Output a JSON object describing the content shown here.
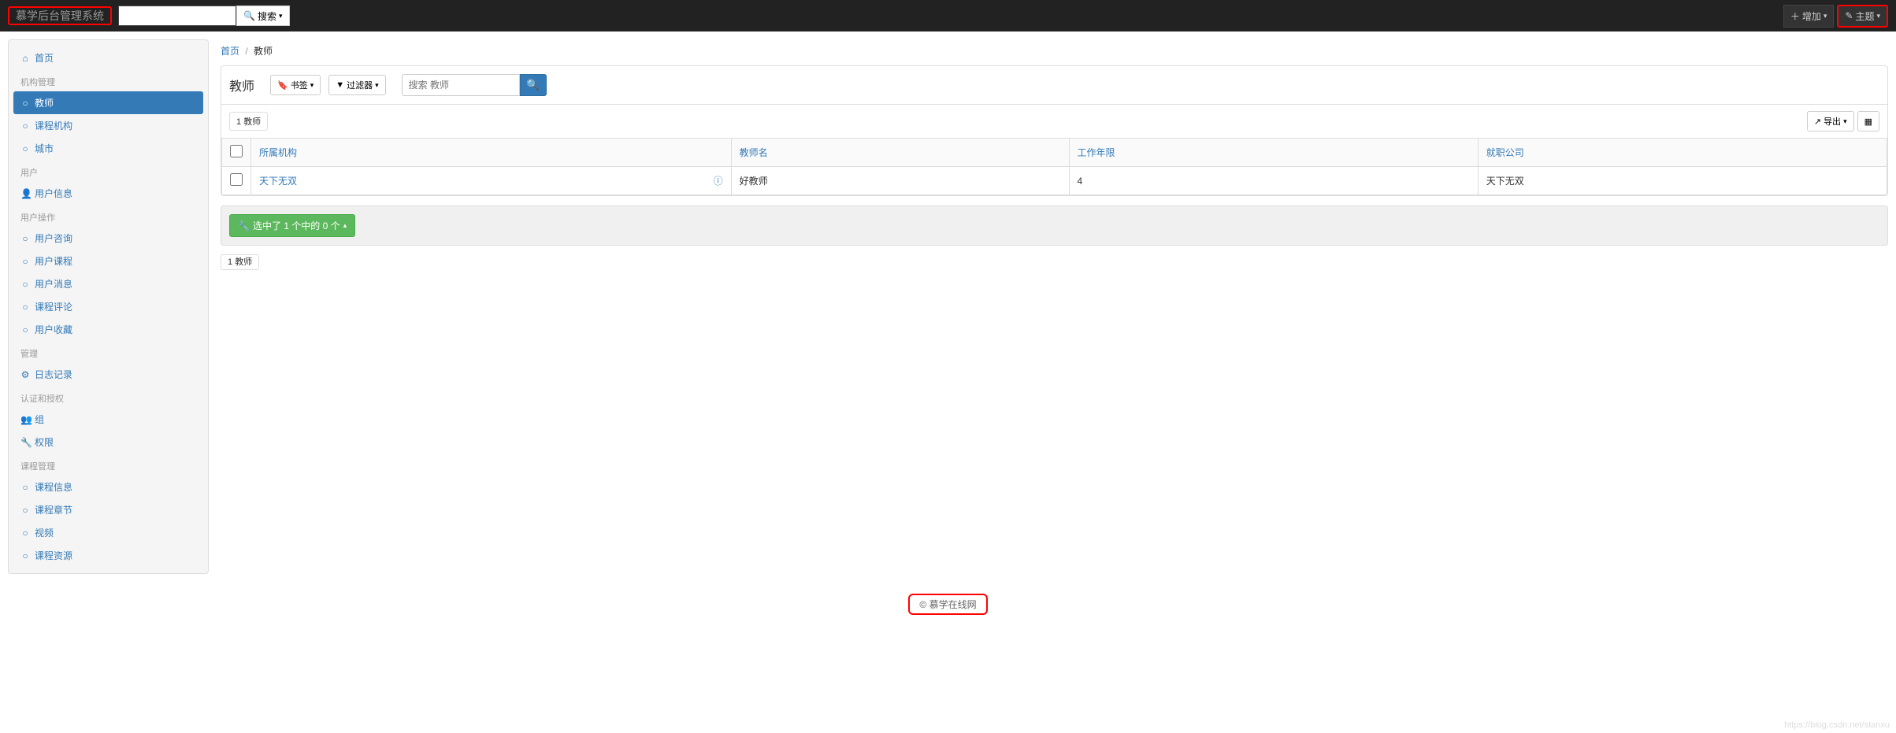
{
  "navbar": {
    "brand": "慕学后台管理系统",
    "search_btn": "搜索",
    "add_btn": "增加",
    "theme_btn": "主题"
  },
  "sidebar": {
    "home": "首页",
    "groups": [
      {
        "title": "机构管理",
        "items": [
          {
            "label": "教师",
            "icon": "○",
            "active": true
          },
          {
            "label": "课程机构",
            "icon": "○"
          },
          {
            "label": "城市",
            "icon": "○"
          }
        ]
      },
      {
        "title": "用户",
        "items": [
          {
            "label": "用户信息",
            "icon": "👤"
          }
        ]
      },
      {
        "title": "用户操作",
        "items": [
          {
            "label": "用户咨询",
            "icon": "○"
          },
          {
            "label": "用户课程",
            "icon": "○"
          },
          {
            "label": "用户消息",
            "icon": "○"
          },
          {
            "label": "课程评论",
            "icon": "○"
          },
          {
            "label": "用户收藏",
            "icon": "○"
          }
        ]
      },
      {
        "title": "管理",
        "items": [
          {
            "label": "日志记录",
            "icon": "⚙"
          }
        ]
      },
      {
        "title": "认证和授权",
        "items": [
          {
            "label": "组",
            "icon": "👥"
          },
          {
            "label": "权限",
            "icon": "🔧"
          }
        ]
      },
      {
        "title": "课程管理",
        "items": [
          {
            "label": "课程信息",
            "icon": "○"
          },
          {
            "label": "课程章节",
            "icon": "○"
          },
          {
            "label": "视频",
            "icon": "○"
          },
          {
            "label": "课程资源",
            "icon": "○"
          }
        ]
      }
    ]
  },
  "breadcrumb": {
    "home": "首页",
    "current": "教师"
  },
  "toolbar": {
    "title": "教师",
    "bookmark": "书签",
    "filter": "过滤器",
    "search_placeholder": "搜索 教师"
  },
  "counter": {
    "count": "1",
    "label": "教师"
  },
  "export_btn": "导出",
  "table": {
    "headers": [
      "所属机构",
      "教师名",
      "工作年限",
      "就职公司"
    ],
    "rows": [
      {
        "org": "天下无双",
        "name": "好教师",
        "years": "4",
        "company": "天下无双"
      }
    ]
  },
  "action": {
    "label": "选中了 1 个中的 0 个"
  },
  "footer": "© 慕学在线网",
  "watermark": "https://blog.csdn.net/stanxu"
}
